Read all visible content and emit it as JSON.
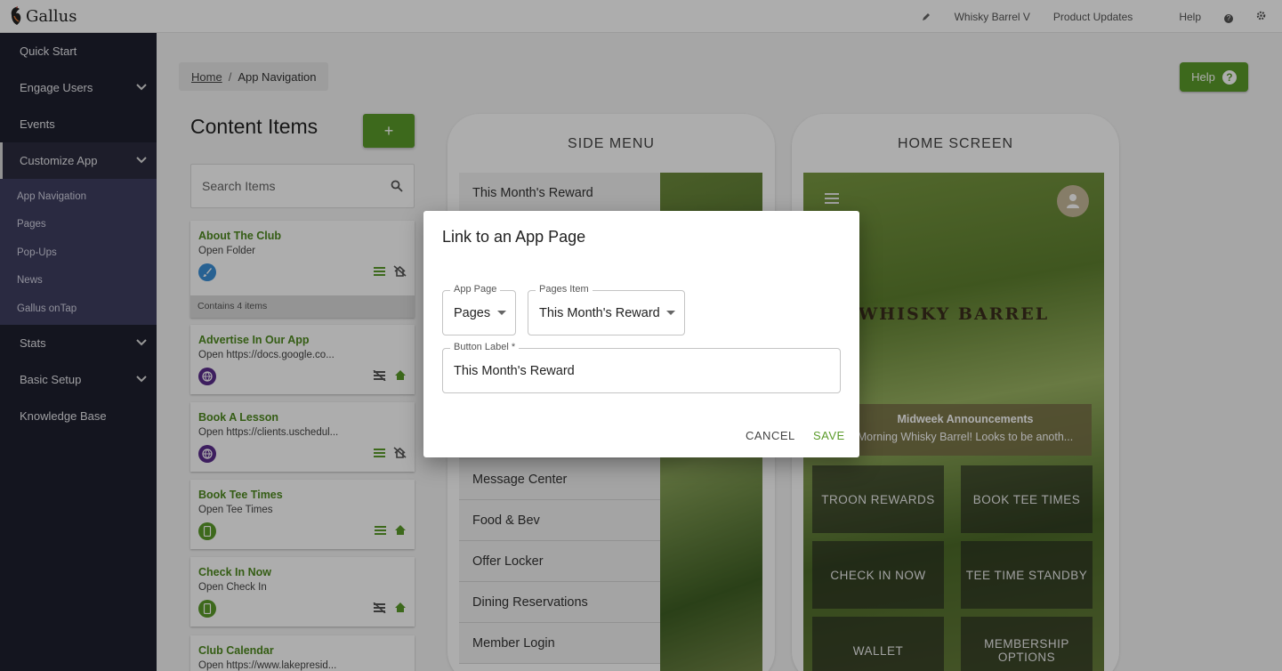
{
  "topbar": {
    "brand": "Gallus",
    "links": [
      "Whisky Barrel V",
      "Product Updates",
      "Help"
    ],
    "icons": [
      "pencil-icon",
      "help-circle-icon",
      "gear-icon"
    ]
  },
  "sidebar": {
    "items": [
      {
        "label": "Quick Start"
      },
      {
        "label": "Engage Users"
      },
      {
        "label": "Events"
      },
      {
        "label": "Customize App"
      },
      {
        "label": "Stats"
      },
      {
        "label": "Basic Setup"
      },
      {
        "label": "Knowledge Base"
      }
    ],
    "subitems": [
      {
        "label": "App Navigation"
      },
      {
        "label": "Pages"
      },
      {
        "label": "Pop-Ups"
      },
      {
        "label": "News"
      },
      {
        "label": "Gallus onTap"
      }
    ]
  },
  "breadcrumb": {
    "home": "Home",
    "sep": "/",
    "current": "App Navigation"
  },
  "help_button": {
    "label": "Help"
  },
  "content": {
    "title": "Content Items",
    "add_label": "+",
    "search_placeholder": "Search Items",
    "cards": [
      {
        "title": "About The Club",
        "subtitle": "Open Folder",
        "icon": "paint-brush-icon",
        "color": "#3a8fd8",
        "footer": "Contains 4 items"
      },
      {
        "title": "Advertise In Our App",
        "subtitle": "Open https://docs.google.co...",
        "icon": "globe-icon",
        "color": "#5a2d8c"
      },
      {
        "title": "Book A Lesson",
        "subtitle": "Open https://clients.uschedul...",
        "icon": "globe-icon",
        "color": "#5a2d8c"
      },
      {
        "title": "Book Tee Times",
        "subtitle": "Open Tee Times",
        "icon": "phone-icon",
        "color": "#5b9b2a"
      },
      {
        "title": "Check In Now",
        "subtitle": "Open Check In",
        "icon": "phone-icon",
        "color": "#5b9b2a"
      },
      {
        "title": "Club Calendar",
        "subtitle": "Open https://www.lakepresid..."
      }
    ]
  },
  "side_menu": {
    "title": "SIDE MENU",
    "items": [
      "This Month's Reward",
      "",
      "",
      "",
      "",
      "",
      "",
      "Message Center",
      "Food & Bev",
      "Offer Locker",
      "Dining Reservations",
      "Member Login"
    ]
  },
  "home_screen": {
    "title": "HOME SCREEN",
    "logo": "WHISKY BARREL",
    "announcement_title": "Midweek Announcements",
    "announcement_body": "Morning Whisky Barrel! Looks to be anoth...",
    "tiles": [
      "TROON REWARDS",
      "BOOK TEE TIMES",
      "CHECK IN NOW",
      "TEE TIME STANDBY",
      "WALLET",
      "MEMBERSHIP OPTIONS"
    ]
  },
  "modal": {
    "title": "Link to an App Page",
    "app_page_label": "App Page",
    "app_page_value": "Pages",
    "pages_item_label": "Pages Item",
    "pages_item_value": "This Month's Reward",
    "button_label_label": "Button Label *",
    "button_label_value": "This Month's Reward",
    "cancel": "CANCEL",
    "save": "SAVE"
  },
  "colors": {
    "accent": "#5b9b2a",
    "sidebar": "#1e1f2e",
    "sidebar_sub": "#3f3f60",
    "title_green": "#4e8a1f"
  }
}
